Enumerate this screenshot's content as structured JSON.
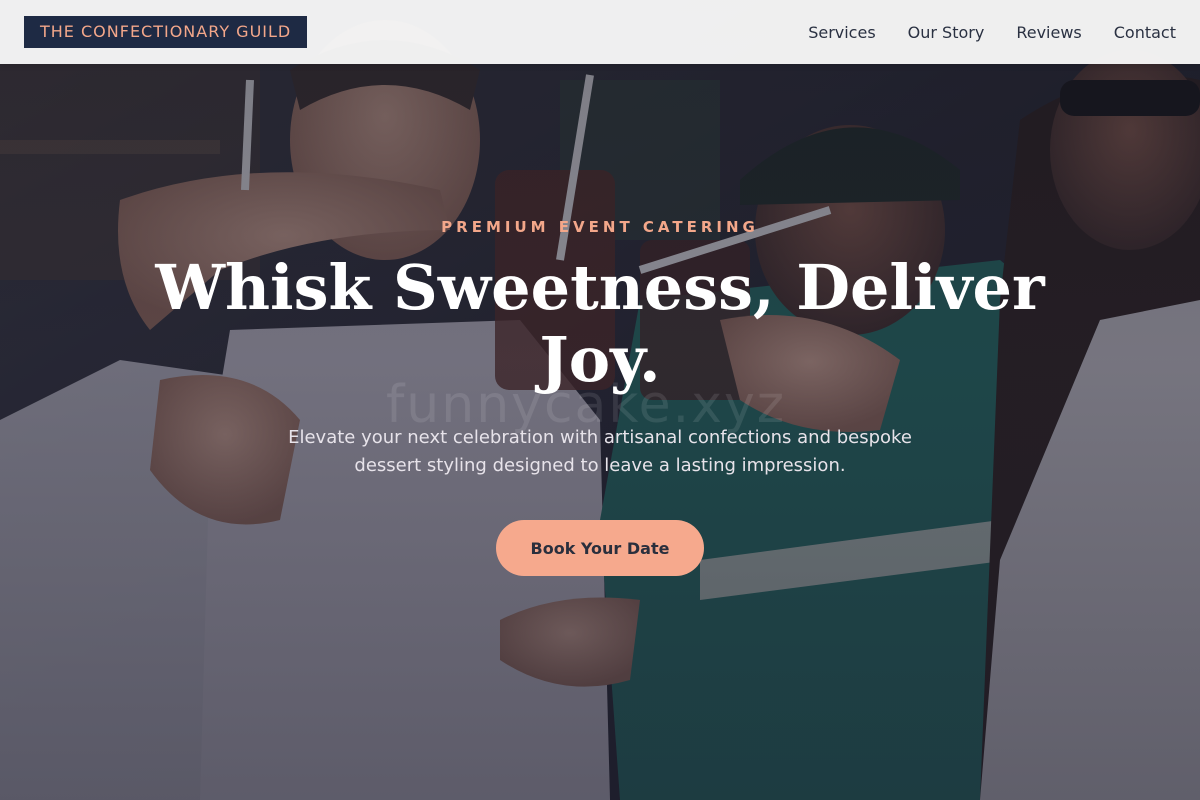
{
  "header": {
    "brand": "THE CONFECTIONARY GUILD",
    "nav": [
      {
        "label": "Services"
      },
      {
        "label": "Our Story"
      },
      {
        "label": "Reviews"
      },
      {
        "label": "Contact"
      }
    ]
  },
  "hero": {
    "eyebrow": "PREMIUM EVENT CATERING",
    "title": "Whisk Sweetness, Deliver Joy.",
    "subtitle": "Elevate your next celebration with artisanal confections and bespoke dessert styling designed to leave a lasting impression.",
    "cta_label": "Book Your Date",
    "watermark": "funnycake.xyz"
  },
  "colors": {
    "accent": "#f6a98d",
    "brand_bg": "#1e2a44",
    "brand_text": "#f3a78a",
    "header_bg": "#f8f8f8",
    "nav_text": "#2a3142"
  }
}
